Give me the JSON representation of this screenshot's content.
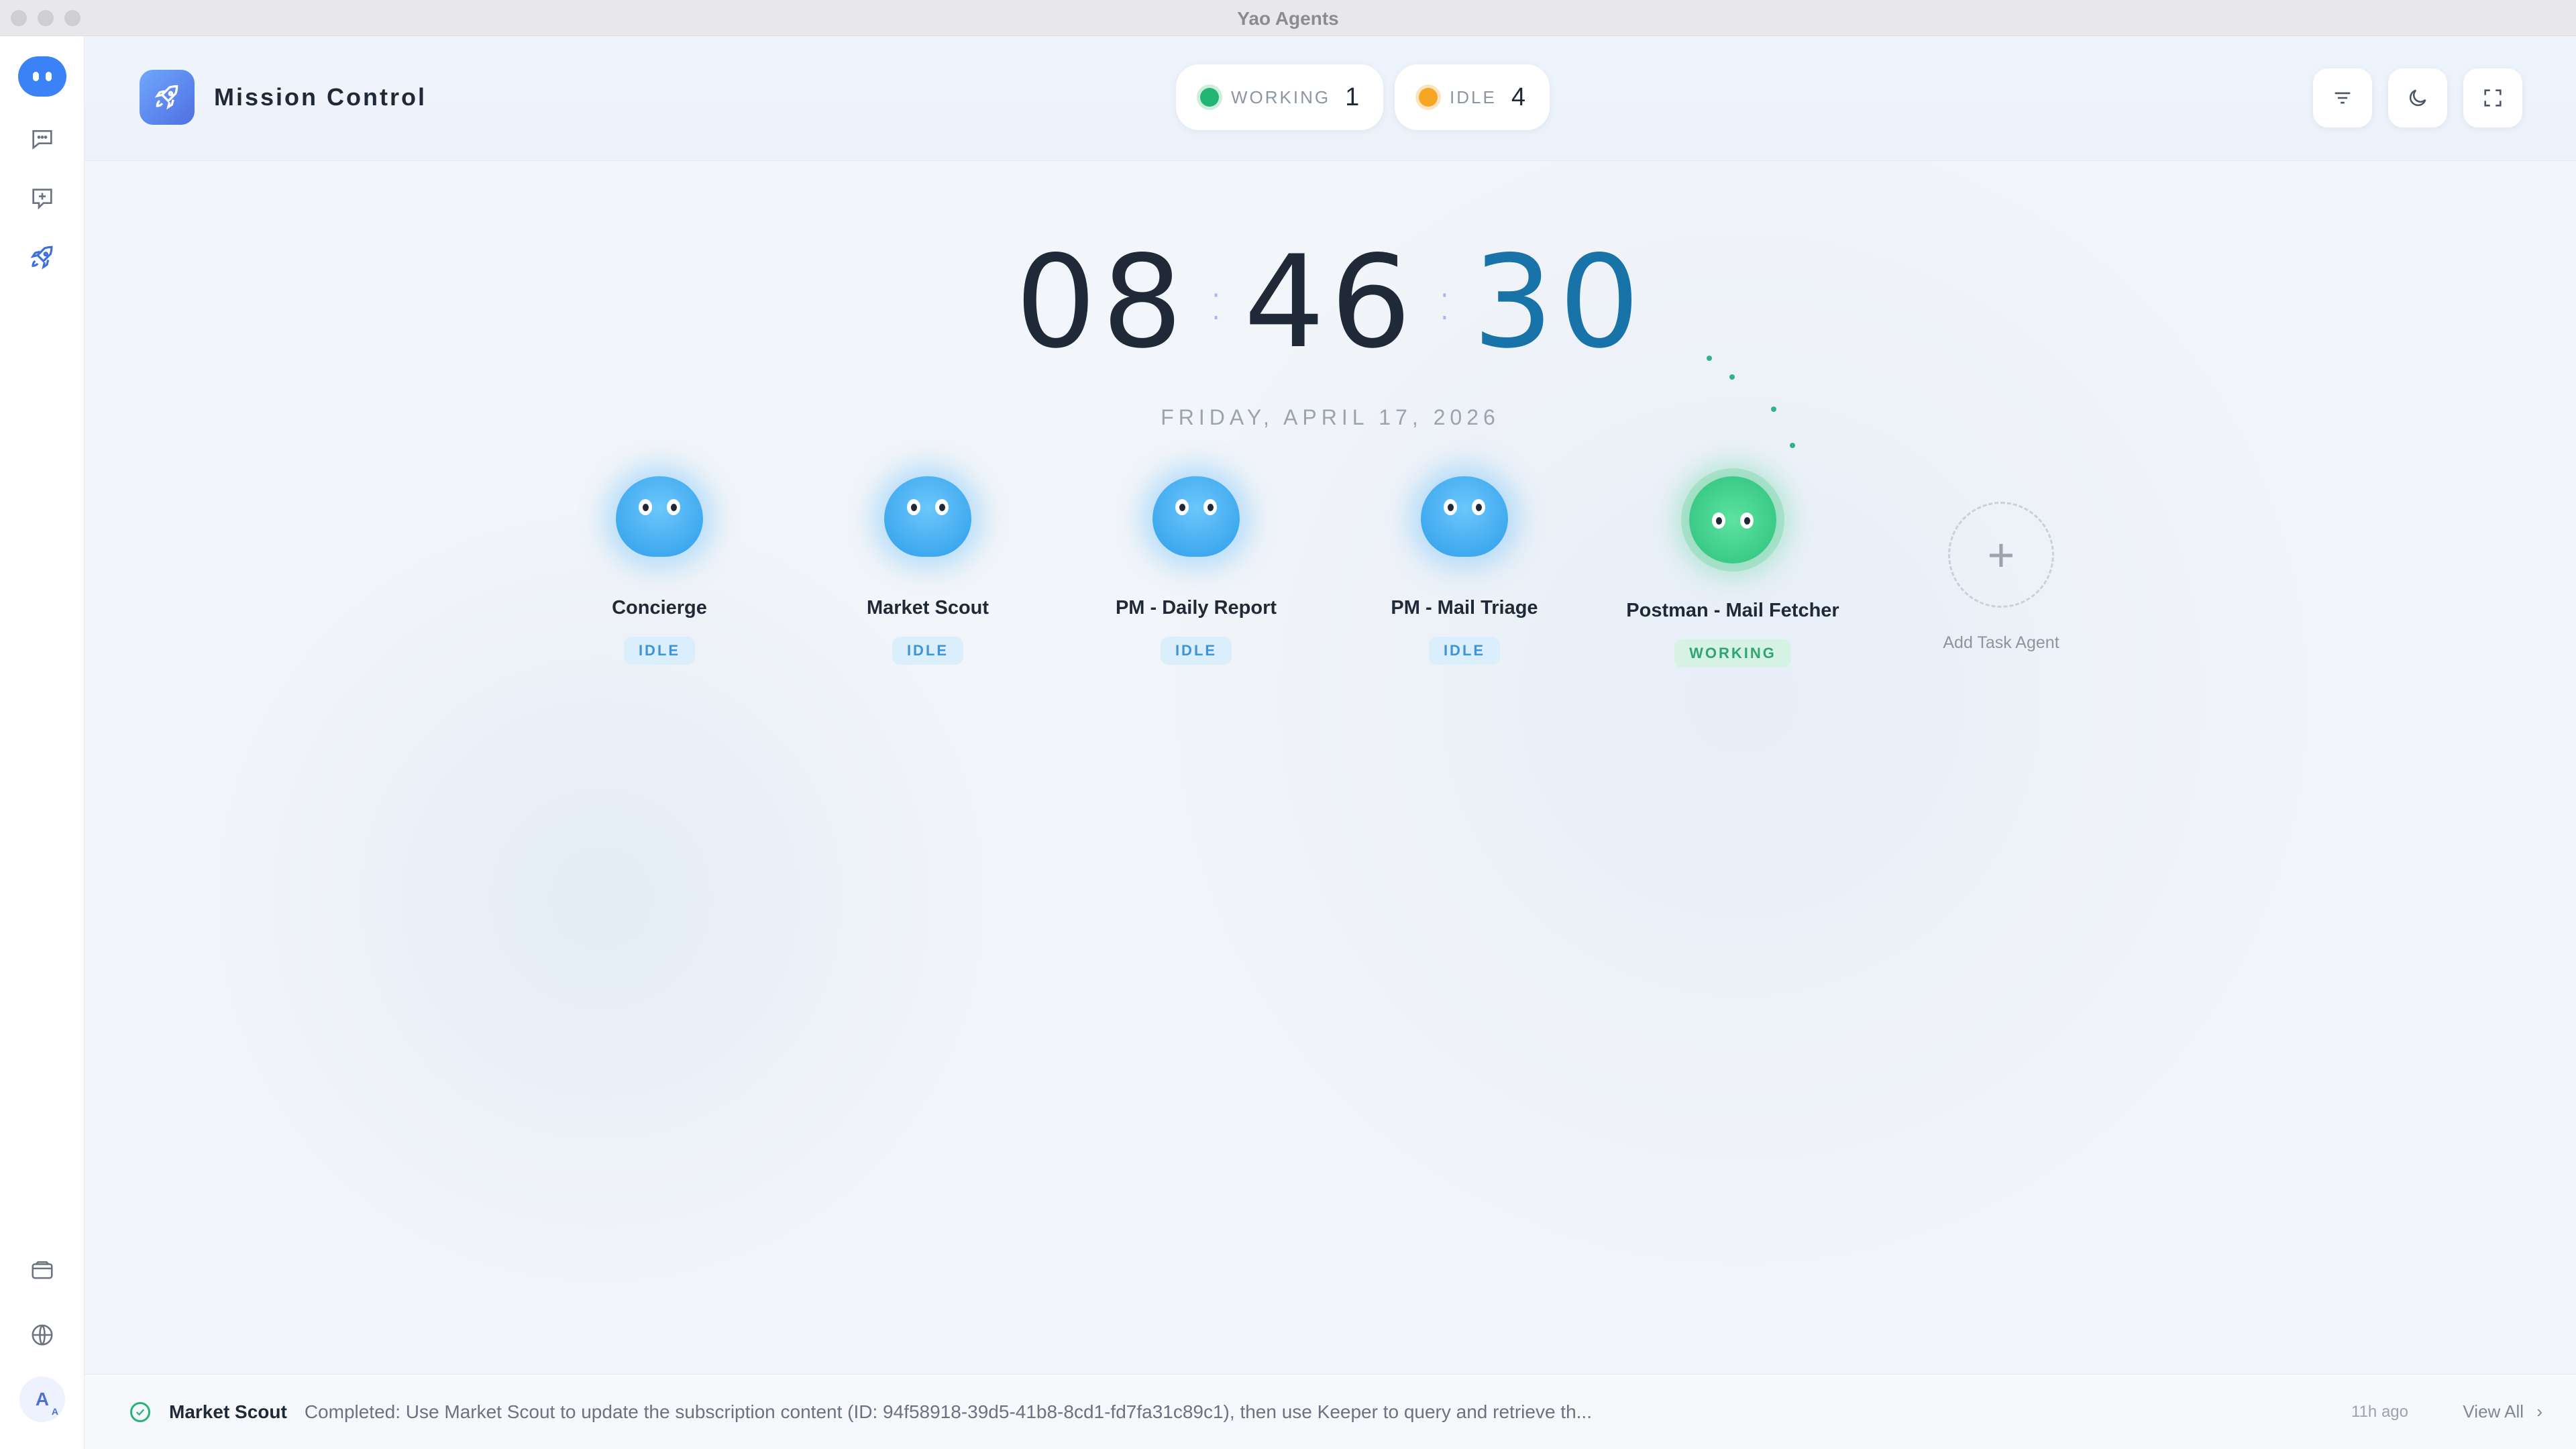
{
  "window": {
    "title": "Yao Agents"
  },
  "header": {
    "title": "Mission Control",
    "status": {
      "working": {
        "label": "WORKING",
        "count": "1",
        "color": "#22b573"
      },
      "idle": {
        "label": "IDLE",
        "count": "4",
        "color": "#f6a623"
      }
    },
    "buttons": [
      "filter-icon",
      "moon-icon",
      "fullscreen-icon"
    ]
  },
  "sidebar": {
    "items": [
      "chat-icon",
      "new-task-icon",
      "rocket-icon"
    ],
    "bottom": [
      "wallet-icon",
      "globe-icon"
    ],
    "avatar": {
      "initial": "A",
      "sub": "A"
    }
  },
  "clock": {
    "hours": "08",
    "minutes": "46",
    "seconds": "30",
    "date": "FRIDAY, APRIL 17, 2026"
  },
  "agents": [
    {
      "name": "Concierge",
      "status": "IDLE"
    },
    {
      "name": "Market Scout",
      "status": "IDLE"
    },
    {
      "name": "PM - Daily Report",
      "status": "IDLE"
    },
    {
      "name": "PM - Mail Triage",
      "status": "IDLE"
    },
    {
      "name": "Postman - Mail Fetcher",
      "status": "WORKING"
    }
  ],
  "add_agent": {
    "label": "Add Task Agent"
  },
  "footer": {
    "agent": "Market Scout",
    "message": "Completed: Use Market Scout to update the subscription content (ID: 94f58918-39d5-41b8-8cd1-fd7fa31c89c1), then use Keeper to query and retrieve th...",
    "time": "11h ago",
    "view_all": "View All"
  }
}
